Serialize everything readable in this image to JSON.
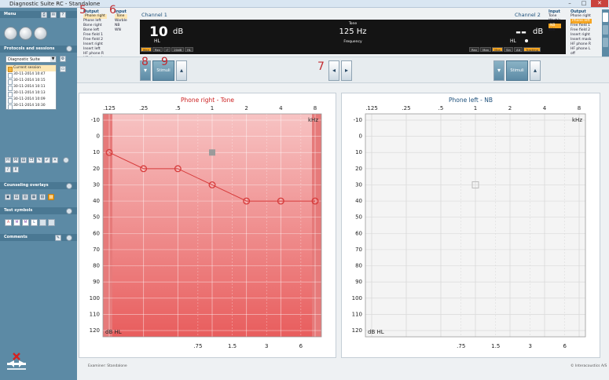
{
  "window": {
    "title": "Diagnostic Suite RC - Standalone",
    "controls": [
      "–",
      "□",
      "✕"
    ]
  },
  "sidebar": {
    "menu_label": "Menu",
    "protocols_label": "Protocols and sessions",
    "protocol_value": "Diagnostic Suite",
    "sessions": [
      "Current session",
      "30-11-2014 10:47",
      "30-11-2014 10:15",
      "30-11-2014 10:11",
      "30-11-2014 10:13",
      "30-11-2014 10:09",
      "30-11-2014 10:30"
    ],
    "counseling_label": "Counseling overlays",
    "test_symbols_label": "Test symbols",
    "comments_label": "Comments",
    "symbol_buttons": [
      "A",
      "M",
      "M",
      "L",
      "",
      ""
    ]
  },
  "channel1": {
    "label": "Channel 1",
    "output_header": "Output",
    "input_header": "Input",
    "outputs": [
      "Phone right",
      "Phone left",
      "Bone right",
      "Bone left",
      "Free field 1",
      "Free field 2",
      "Insert right",
      "Insert left",
      "HF phone R",
      "HF phone L"
    ],
    "inputs": [
      "Tone",
      "Warble",
      "NB",
      "WN"
    ],
    "level": "10",
    "level_unit": "dB",
    "level_ref": "HL",
    "buttons": [
      "Man",
      "Rev",
      "⏎",
      "20dB",
      "HL"
    ]
  },
  "center": {
    "tone_label": "Tone",
    "frequency": "125 Hz",
    "frequency_label": "Frequency"
  },
  "channel2": {
    "label": "Channel 2",
    "output_header": "Output",
    "input_header": "Input",
    "outputs": [
      "Phone right",
      "Phone left",
      "Free field 1",
      "Free field 2",
      "Insert right",
      "Insert mask",
      "HF phone R",
      "HF phone L",
      "off"
    ],
    "inputs": [
      "Tone",
      "Warble",
      "NB",
      "WN"
    ],
    "level": "--",
    "level_unit": "dB",
    "level_ref": "HL",
    "buttons": [
      "Rev",
      "Man",
      "Man",
      "Sin",
      "Alt",
      "Tracking"
    ]
  },
  "controls": {
    "stim1": "Stimuli",
    "stim2": "Stimuli",
    "num7": "7",
    "num8": "8",
    "num9": "9",
    "num5": "5",
    "num6": "6"
  },
  "chart_data": [
    {
      "type": "scatter",
      "title": "Phone right - Tone",
      "x_top_ticks": [
        ".125",
        ".25",
        ".5",
        "1",
        "2",
        "4",
        "8"
      ],
      "x_bottom_ticks": [
        ".75",
        "1.5",
        "3",
        "6"
      ],
      "y_ticks": [
        "-10",
        "0",
        "10",
        "20",
        "30",
        "40",
        "50",
        "60",
        "70",
        "80",
        "90",
        "100",
        "110",
        "120"
      ],
      "ylabel": "dB HL",
      "x_unit": "kHz",
      "ylim": [
        -10,
        120
      ],
      "series": [
        {
          "x": [
            0.125,
            0.25,
            0.5,
            1,
            2,
            4,
            8
          ],
          "y": [
            10,
            20,
            20,
            30,
            40,
            40,
            40
          ],
          "marker": "circle",
          "color": "#d63a3a"
        }
      ],
      "marker_square": {
        "x": 1,
        "y": 10
      },
      "colors": {
        "bg_top": "#f7c3c3",
        "bg_bottom": "#e85d5d",
        "edge": "#e67a7a",
        "line": "#d63a3a"
      }
    },
    {
      "type": "scatter",
      "title": "Phone left - NB",
      "x_top_ticks": [
        ".125",
        ".25",
        ".5",
        "1",
        "2",
        "4",
        "8"
      ],
      "x_bottom_ticks": [
        ".75",
        "1.5",
        "3",
        "6"
      ],
      "y_ticks": [
        "-10",
        "0",
        "10",
        "20",
        "30",
        "40",
        "50",
        "60",
        "70",
        "80",
        "90",
        "100",
        "110",
        "120"
      ],
      "ylabel": "dB HL",
      "x_unit": "kHz",
      "ylim": [
        -10,
        120
      ],
      "series": [],
      "marker_square": {
        "x": 1,
        "y": 30
      },
      "colors": {
        "bg": "#f4f4f4",
        "grid": "#d9d9d9"
      }
    }
  ],
  "status": {
    "left": "Examiner: Standalone",
    "right": "© Interacoustics A/S"
  }
}
